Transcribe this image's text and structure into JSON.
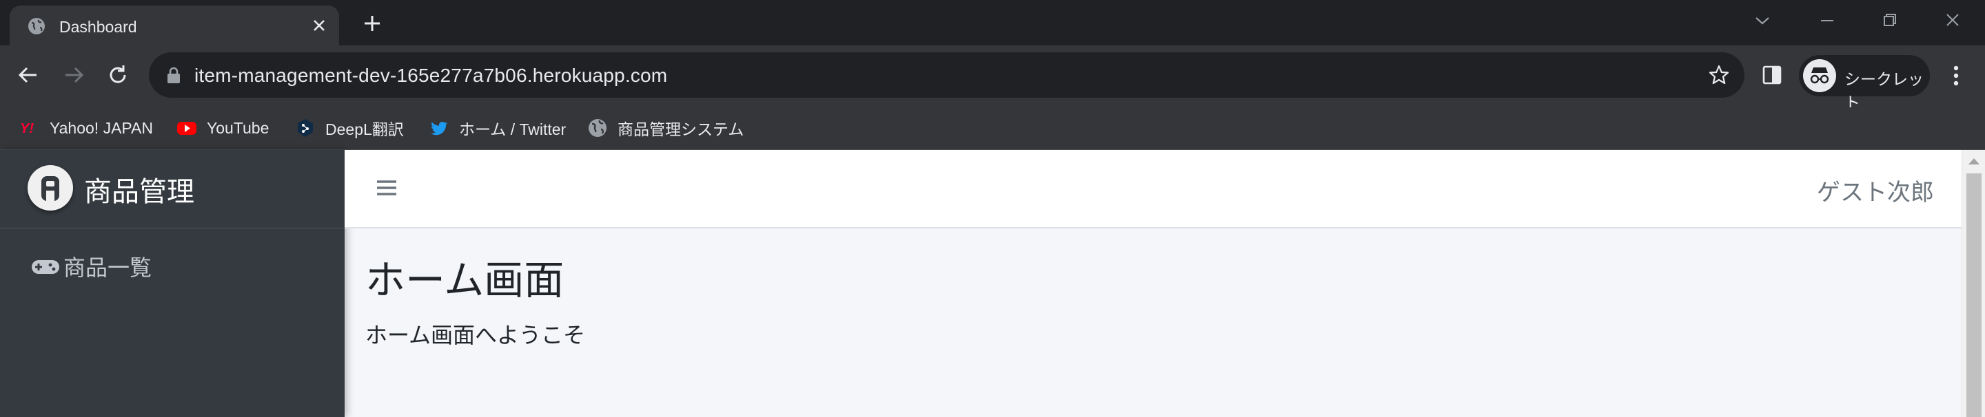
{
  "browser": {
    "tab": {
      "title": "Dashboard"
    },
    "url": "item-management-dev-165e277a7b06.herokuapp.com",
    "profile_label": "シークレット",
    "bookmarks": [
      {
        "label": "Yahoo! JAPAN",
        "icon": "yahoo-icon"
      },
      {
        "label": "YouTube",
        "icon": "youtube-icon"
      },
      {
        "label": "DeepL翻訳",
        "icon": "deepl-icon"
      },
      {
        "label": "ホーム / Twitter",
        "icon": "twitter-icon"
      },
      {
        "label": "商品管理システム",
        "icon": "globe-icon"
      }
    ]
  },
  "app": {
    "brand": "商品管理",
    "sidebar": {
      "items": [
        {
          "label": "商品一覧",
          "icon": "gamepad-icon"
        }
      ]
    },
    "header": {
      "user": "ゲスト次郎"
    },
    "main": {
      "title": "ホーム画面",
      "message": "ホーム画面へようこそ"
    }
  },
  "colors": {
    "sidebar_bg": "#343a40",
    "content_bg": "#f4f6f9",
    "chrome_dark": "#202124",
    "chrome_toolbar": "#35363a"
  }
}
